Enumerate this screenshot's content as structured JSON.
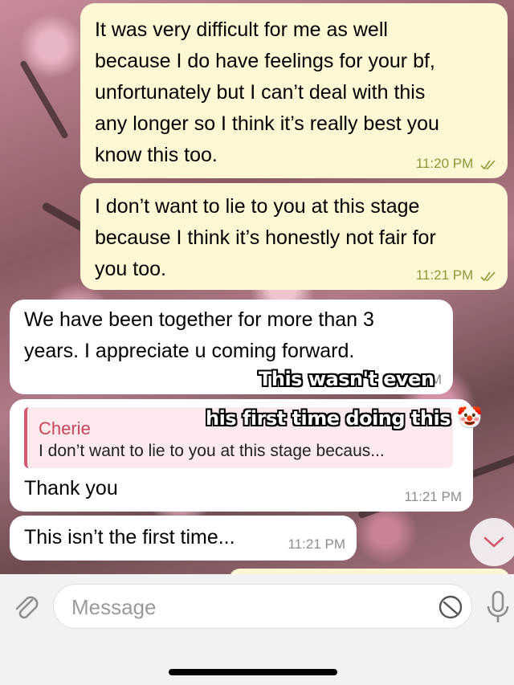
{
  "messages": [
    {
      "direction": "outgoing",
      "lines": [
        "It was very difficult for me as well",
        "because I do have feelings for your bf,",
        "unfortunately but I can’t deal with this",
        "any longer so I think it’s really best you",
        "know this too."
      ],
      "time": "11:20 PM",
      "status": "read-double-check"
    },
    {
      "direction": "outgoing",
      "lines": [
        "I don’t want to lie to you at this stage",
        "because I think it’s honestly not fair for",
        "you too."
      ],
      "time": "11:21 PM",
      "status": "read-double-check"
    },
    {
      "direction": "incoming",
      "lines": [
        "We have been together for more than 3",
        "years. I appreciate u coming forward."
      ],
      "time": "PM"
    },
    {
      "direction": "incoming",
      "reply_to": {
        "name": "Cherie",
        "text": "I don’t want to lie to you at this stage becaus..."
      },
      "lines": [
        "Thank you"
      ],
      "time": "11:21 PM"
    },
    {
      "direction": "incoming",
      "lines": [
        "This isn’t the first time..."
      ],
      "time": "11:21 PM"
    }
  ],
  "overlay": {
    "line1": "This wasn't even",
    "line2": "his first time doing this",
    "emoji": "🤡"
  },
  "input": {
    "placeholder": "Message"
  },
  "icons": {
    "attach": "paperclip-icon",
    "sticker": "sticker-icon",
    "mic": "microphone-icon",
    "scroll": "chevron-down-icon"
  },
  "colors": {
    "outgoing_bubble": "#fdf7d3",
    "incoming_bubble": "#ffffff",
    "outgoing_time": "#8a9a3a",
    "reply_accent": "#d4586f",
    "icon_gray": "#8e8e93"
  }
}
